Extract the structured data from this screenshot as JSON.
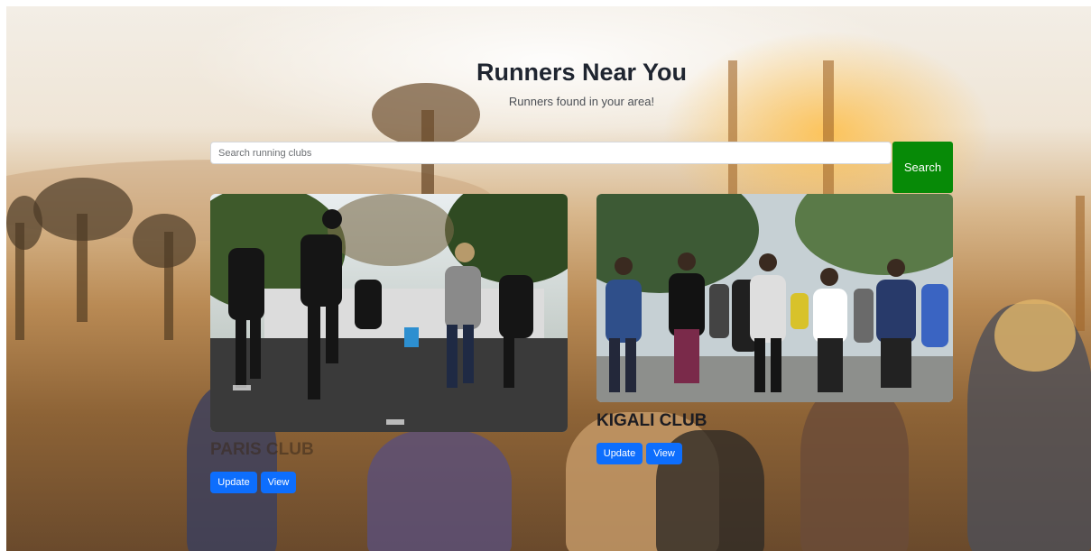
{
  "header": {
    "title": "Runners Near You",
    "subtitle": "Runners found in your area!"
  },
  "search": {
    "placeholder": "Search running clubs",
    "button_label": "Search"
  },
  "clubs": [
    {
      "name": "PARIS CLUB",
      "update_label": "Update",
      "view_label": "View",
      "photo": "group-running-photo"
    },
    {
      "name": "KIGALI CLUB",
      "update_label": "Update",
      "view_label": "View",
      "photo": "crowd-walking-photo"
    }
  ],
  "colors": {
    "search_button": "#078a07",
    "action_button": "#0d6efd",
    "title": "#1f2530"
  }
}
